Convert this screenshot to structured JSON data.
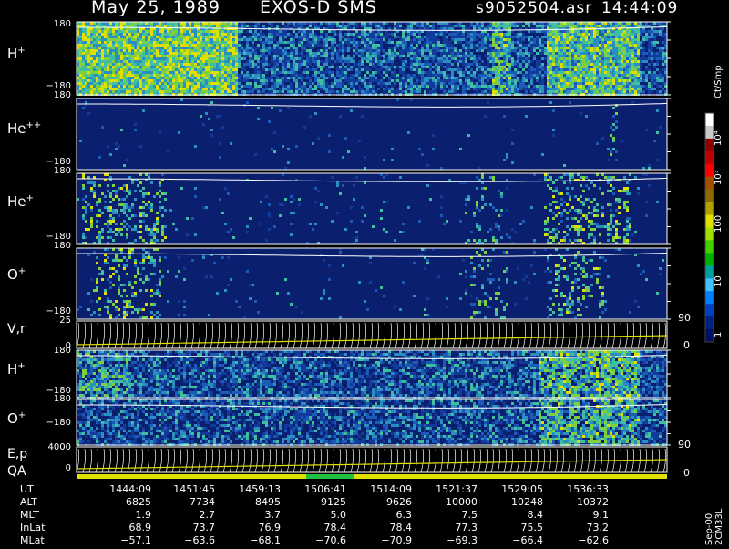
{
  "header": {
    "date": "May 25, 1989",
    "instrument": "EXOS-D SMS",
    "file": "s9052504.asr",
    "time": "14:44:09"
  },
  "panels": [
    {
      "id": "h-plus-1",
      "species": "H",
      "charge": "+",
      "ytop": "180",
      "ybot": "−180",
      "y": 22
    },
    {
      "id": "he-plus-plus",
      "species": "He",
      "charge": "++",
      "ytop": "180",
      "ybot": "−180",
      "y": 105
    },
    {
      "id": "he-plus",
      "species": "He",
      "charge": "+",
      "ytop": "180",
      "ybot": "−180",
      "y": 188
    },
    {
      "id": "o-plus-1",
      "species": "O",
      "charge": "+",
      "ytop": "180",
      "ybot": "−180",
      "y": 270
    }
  ],
  "vr_panel": {
    "label": "V,r",
    "ytop": "25",
    "ybot": "0",
    "rtop": "90",
    "rbot": "0"
  },
  "h2_panel": {
    "species": "H",
    "charge": "+",
    "ytop": "180",
    "ybot": "−180"
  },
  "o2_panel": {
    "species": "O",
    "charge": "+",
    "ytop": "180",
    "ybot": "−180"
  },
  "ep_panel": {
    "label1": "E,p",
    "label2": "QA",
    "ytop": "4000",
    "ybot": "0",
    "rtop": "90",
    "rbot": "0"
  },
  "colorbar": {
    "unit": "Ct/Smp",
    "ticks": [
      "10⁴",
      "10³",
      "100",
      "10",
      "1"
    ],
    "colors": [
      "#ffffff",
      "#c8c8c8",
      "#8b0000",
      "#c00000",
      "#ff0000",
      "#a05000",
      "#8b6b00",
      "#b0a000",
      "#e0e000",
      "#a0e000",
      "#40d000",
      "#00b000",
      "#00a0a0",
      "#40c0ff",
      "#0080ff",
      "#0040c0",
      "#002080",
      "#001060"
    ]
  },
  "table": {
    "rows": [
      {
        "label": "UT",
        "values": [
          "1444:09",
          "1451:45",
          "1459:13",
          "1506:41",
          "1514:09",
          "1521:37",
          "1529:05",
          "1536:33"
        ]
      },
      {
        "label": "ALT",
        "values": [
          "6825",
          "7734",
          "8495",
          "9125",
          "9626",
          "10000",
          "10248",
          "10372"
        ]
      },
      {
        "label": "MLT",
        "values": [
          "1.9",
          "2.7",
          "3.7",
          "5.0",
          "6.3",
          "7.5",
          "8.4",
          "9.1"
        ]
      },
      {
        "label": "InLat",
        "values": [
          "68.9",
          "73.7",
          "76.9",
          "78.4",
          "78.4",
          "77.3",
          "75.5",
          "73.2"
        ]
      },
      {
        "label": "MLat",
        "values": [
          "−57.1",
          "−63.6",
          "−68.1",
          "−70.6",
          "−70.9",
          "−69.3",
          "−66.4",
          "−62.6"
        ]
      }
    ]
  },
  "footer": "Sep-00 2CM33L",
  "chart_data": {
    "type": "heatmap",
    "title": "May 25, 1989   EXOS-D SMS",
    "panels": [
      "H+",
      "He++",
      "He+",
      "O+",
      "V,r",
      "H+",
      "O+",
      "E,p / QA"
    ],
    "x_ticks": [
      "1444:09",
      "1451:45",
      "1459:13",
      "1506:41",
      "1514:09",
      "1521:37",
      "1529:05",
      "1536:33"
    ],
    "pitch_angle_range": [
      -180,
      180
    ],
    "colorbar_range": [
      1,
      10000
    ],
    "colorbar_scale": "log",
    "colorbar_label": "Ct/Smp"
  }
}
